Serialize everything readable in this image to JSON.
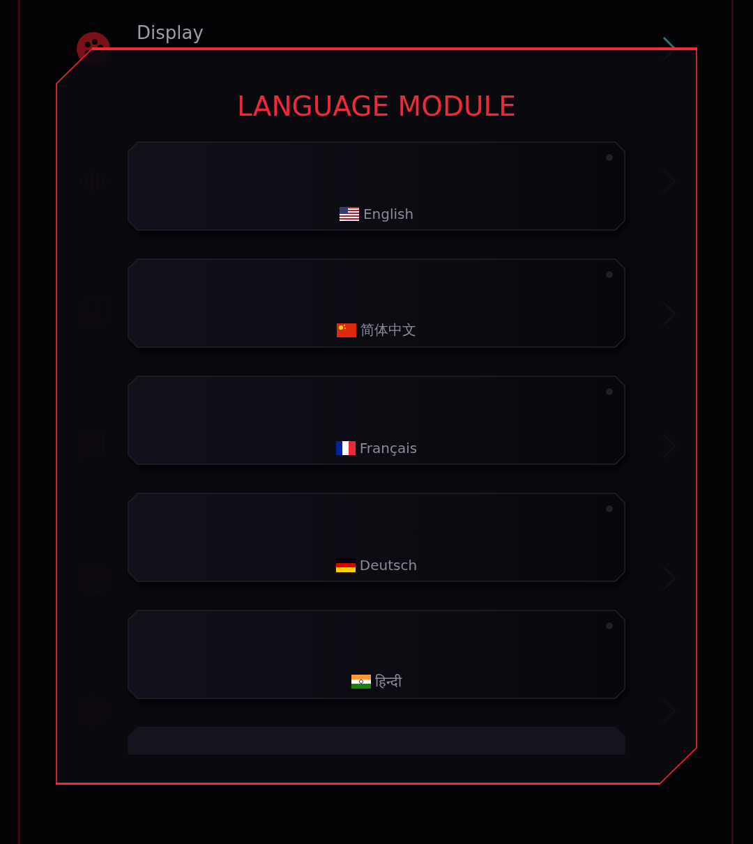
{
  "background_list": {
    "items": [
      {
        "kind": "palette",
        "title": "Display"
      },
      {
        "kind": "waveform"
      },
      {
        "kind": "library"
      },
      {
        "kind": "playlist"
      },
      {
        "kind": "globe"
      },
      {
        "kind": "info"
      }
    ]
  },
  "dialog": {
    "title": "LANGUAGE MODULE",
    "options": [
      {
        "kind": "us",
        "label": "English"
      },
      {
        "kind": "cn",
        "label": "简体中文"
      },
      {
        "kind": "fr",
        "label": "Français"
      },
      {
        "kind": "de",
        "label": "Deutsch"
      },
      {
        "kind": "in",
        "label": "हिन्दी"
      }
    ]
  }
}
